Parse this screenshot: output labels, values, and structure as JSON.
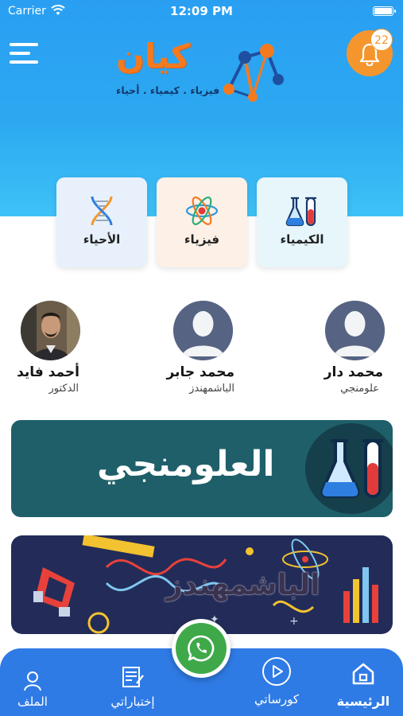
{
  "status_bar": {
    "carrier": "Carrier",
    "time": "12:09 PM"
  },
  "header": {
    "logo_word": "كيان",
    "logo_subtitle": "فيزياء . كيمياء . أحياء",
    "notification_count": "22"
  },
  "categories": [
    {
      "label": "الكيمياء",
      "icon": "chemistry-flask-icon",
      "bg": "#e6f6fb"
    },
    {
      "label": "فيزياء",
      "icon": "atom-icon",
      "bg": "#fdf0e6"
    },
    {
      "label": "الأحياء",
      "icon": "dna-icon",
      "bg": "#e8f1fb"
    }
  ],
  "teachers": [
    {
      "name": "محمد دار",
      "title": "علومنجي"
    },
    {
      "name": "محمد جابر",
      "title": "الباشمهندز"
    },
    {
      "name": "أحمد فايد",
      "title": "الدكتور"
    }
  ],
  "banners": [
    {
      "text": "العلومنجي",
      "bg": "#1e5f6a"
    },
    {
      "text": "الباشمهندز",
      "bg": "#232c58"
    }
  ],
  "bottom_nav": [
    {
      "label": "الرئيسية",
      "icon": "home-icon",
      "active": true
    },
    {
      "label": "كورساتي",
      "icon": "play-circle-icon"
    },
    {
      "label": "إختباراتي",
      "icon": "exam-icon"
    },
    {
      "label": "الملف",
      "icon": "profile-icon"
    }
  ],
  "colors": {
    "header": "#2a9ff2",
    "accent": "#f47a20",
    "nav": "#2f7be5",
    "whatsapp": "#3fa94a"
  }
}
